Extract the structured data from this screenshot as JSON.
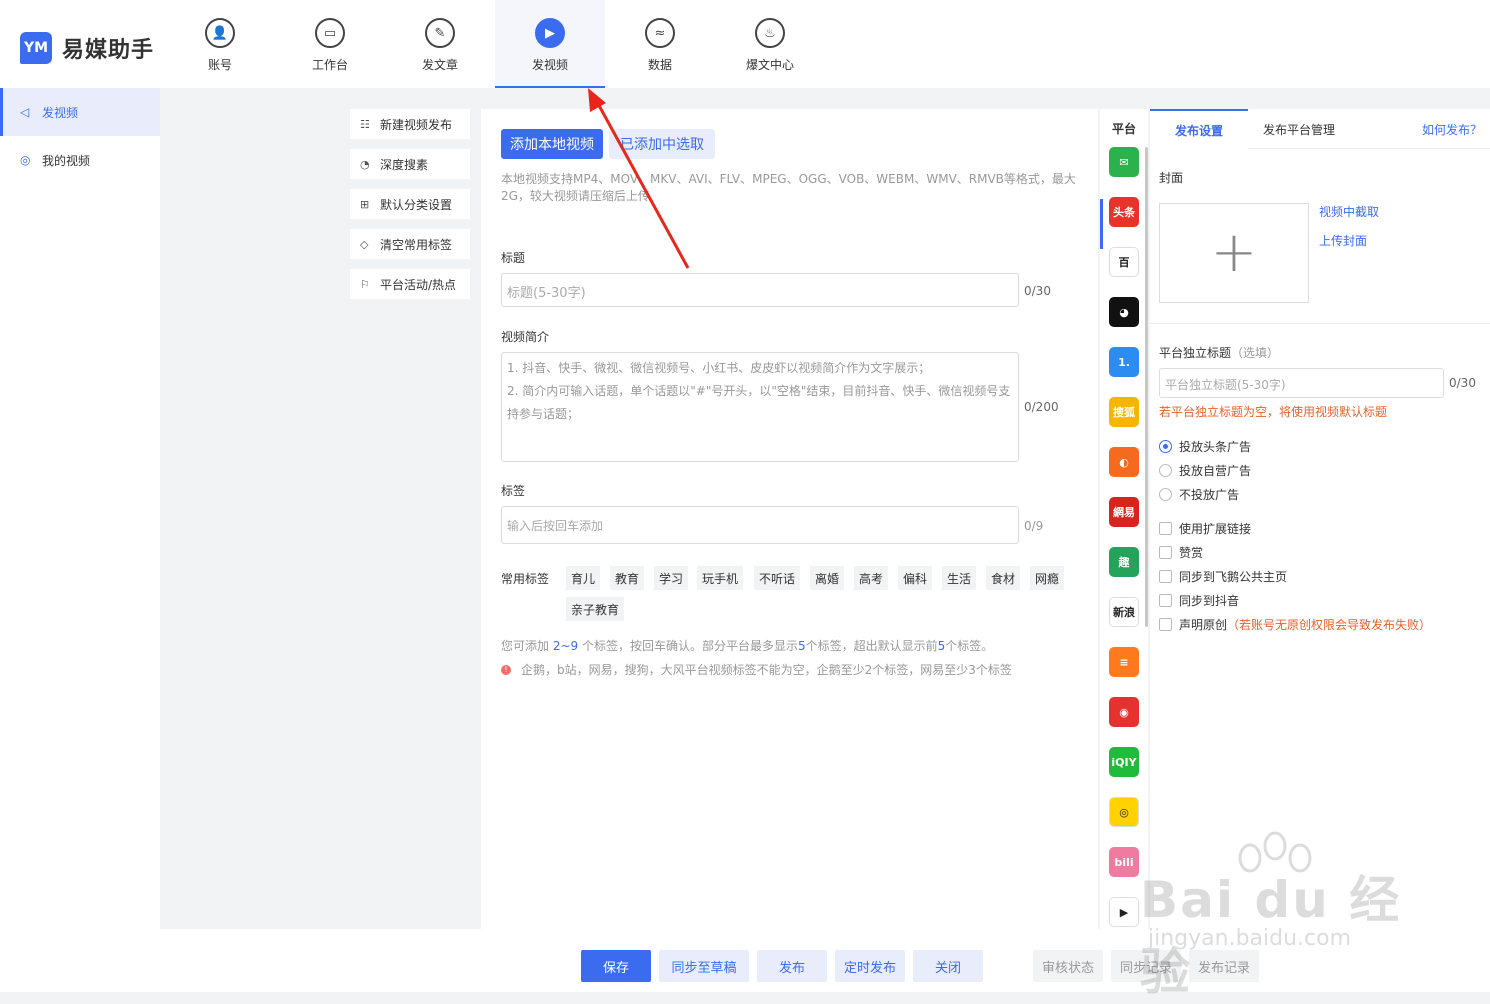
{
  "app": {
    "logo_mark": "YM",
    "name": "易媒助手"
  },
  "nav": {
    "items": [
      {
        "label": "账号",
        "glyph": "👤"
      },
      {
        "label": "工作台",
        "glyph": "▭"
      },
      {
        "label": "发文章",
        "glyph": "✎"
      },
      {
        "label": "发视频",
        "glyph": "▶"
      },
      {
        "label": "数据",
        "glyph": "≈"
      },
      {
        "label": "爆文中心",
        "glyph": "♨"
      }
    ],
    "active": "发视频"
  },
  "sidebar": {
    "items": [
      {
        "label": "发视频",
        "icon": "send-icon",
        "glyph": "◁"
      },
      {
        "label": "我的视频",
        "icon": "play-circle-icon",
        "glyph": "◎"
      }
    ]
  },
  "tools": {
    "items": [
      {
        "label": "新建视频发布",
        "glyph": "☷"
      },
      {
        "label": "深度搜素",
        "glyph": "◔"
      },
      {
        "label": "默认分类设置",
        "glyph": "⊞"
      },
      {
        "label": "清空常用标签",
        "glyph": "◇"
      },
      {
        "label": "平台活动/热点",
        "glyph": "⚐"
      }
    ]
  },
  "main": {
    "add_local_btn": "添加本地视频",
    "select_added_btn": "已添加中选取",
    "format_hint": "本地视频支持MP4、MOV、MKV、AVI、FLV、MPEG、OGG、VOB、WEBM、WMV、RMVB等格式，最大2G，较大视频请压缩后上传",
    "title_label": "标题",
    "title_placeholder": "标题(5-30字)",
    "title_counter": "0/30",
    "desc_label": "视频简介",
    "desc_lines": [
      "1. 抖音、快手、微视、微信视频号、小红书、皮皮虾以视频简介作为文字展示；",
      "2. 简介内可输入话题，单个话题以\"#\"号开头，以\"空格\"结束，目前抖音、快手、微信视频号支",
      "持参与话题；"
    ],
    "desc_counter": "0/200",
    "tags_label": "标签",
    "tags_placeholder": "输入后按回车添加",
    "tags_counter": "0/9",
    "common_tags_label": "常用标签",
    "common_tags": [
      "育儿",
      "教育",
      "学习",
      "玩手机",
      "不听话",
      "离婚",
      "高考",
      "偏科",
      "生活",
      "食材",
      "网瘾",
      "亲子教育"
    ],
    "note1_a": "您可添加 ",
    "note1_range": "2~9",
    "note1_b": " 个标签，按回车确认。部分平台最多显示",
    "note1_n1": "5",
    "note1_c": "个标签，超出默认显示前",
    "note1_n2": "5",
    "note1_d": "个标签。",
    "note2": "企鹅，b站，网易，搜狗，大风平台视频标签不能为空，企鹅至少2个标签，网易至少3个标签"
  },
  "platforms": {
    "header": "平台",
    "items": [
      {
        "name": "wechat-channels",
        "glyph": "✉",
        "color": "#2bb24c"
      },
      {
        "name": "toutiao",
        "glyph": "头条",
        "color": "#e8332a"
      },
      {
        "name": "baijiahao",
        "glyph": "百",
        "color": "#ffffff"
      },
      {
        "name": "qq-penguin",
        "glyph": "◕",
        "color": "#111111"
      },
      {
        "name": "yidian",
        "glyph": "1.",
        "color": "#2d8cf0"
      },
      {
        "name": "sohu",
        "glyph": "搜狐",
        "color": "#f7b500"
      },
      {
        "name": "dayu",
        "glyph": "◐",
        "color": "#f56a1f"
      },
      {
        "name": "netease",
        "glyph": "網易",
        "color": "#d8231f"
      },
      {
        "name": "qutoutiao",
        "glyph": "趣",
        "color": "#23a45a"
      },
      {
        "name": "sina",
        "glyph": "新浪",
        "color": "#ffffff"
      },
      {
        "name": "bilibili-orange",
        "glyph": "≡",
        "color": "#ff7a1e"
      },
      {
        "name": "ifeng",
        "glyph": "◉",
        "color": "#e6322e"
      },
      {
        "name": "iqiyi",
        "glyph": "iQIY",
        "color": "#20bb3a"
      },
      {
        "name": "miaopai",
        "glyph": "◎",
        "color": "#ffd200"
      },
      {
        "name": "bilibili",
        "glyph": "bili",
        "color": "#f07aa0"
      },
      {
        "name": "tencent-video",
        "glyph": "▶",
        "color": "#ffffff"
      }
    ]
  },
  "settings": {
    "tab_publish": "发布设置",
    "tab_platform": "发布平台管理",
    "howto": "如何发布？",
    "cover_label": "封面",
    "cover_plus": "+",
    "capture_link": "视频中截取",
    "upload_link": "上传封面",
    "indep_title_label": "平台独立标题",
    "indep_title_optional": "（选填）",
    "indep_title_placeholder": "平台独立标题(5-30字)",
    "indep_title_counter": "0/30",
    "indep_title_warn": "若平台独立标题为空，将使用视频默认标题",
    "ad_options": [
      "投放头条广告",
      "投放自营广告",
      "不投放广告"
    ],
    "checks": [
      "使用扩展链接",
      "赞赏",
      "同步到飞鹅公共主页",
      "同步到抖音"
    ],
    "original_label": "声明原创",
    "original_warn": "（若账号无原创权限会导致发布失败）"
  },
  "footer": {
    "save": "保存",
    "sync_draft": "同步至草稿",
    "publish": "发布",
    "schedule": "定时发布",
    "close": "关闭",
    "review_status": "审核状态",
    "sync_record": "同步记录",
    "publish_record": "发布记录"
  },
  "watermark": {
    "big": "Bai du 经验",
    "small": "jingyan.baidu.com"
  }
}
